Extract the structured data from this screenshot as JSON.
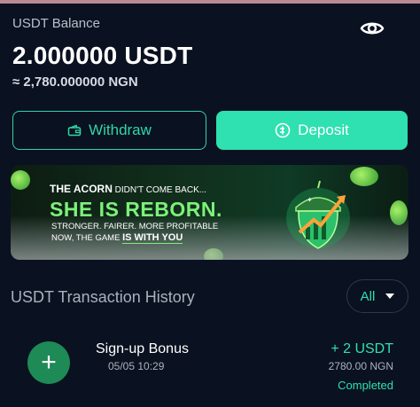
{
  "balance": {
    "label": "USDT Balance",
    "amount": "2.000000 USDT",
    "fiat": "≈ 2,780.000000 NGN",
    "visibility_icon": "eye-icon"
  },
  "actions": {
    "withdraw_label": "Withdraw",
    "withdraw_icon": "wallet-icon",
    "deposit_label": "Deposit",
    "deposit_icon": "deposit-icon"
  },
  "banner": {
    "line1_bold": "THE ACORN",
    "line1_rest": " DIDN'T COME BACK...",
    "line2": "SHE IS REBORN.",
    "line3": "STRONGER. FAIRER. MORE PROFITABLE",
    "line4_prefix": "NOW, THE GAME ",
    "line4_bold": "IS WITH YOU"
  },
  "history": {
    "title": "USDT Transaction History",
    "filter_value": "All"
  },
  "transactions": [
    {
      "title": "Sign-up Bonus",
      "date": "05/05 10:29",
      "amount": "+ 2 USDT",
      "fiat": "2780.00 NGN",
      "status": "Completed",
      "icon": "plus-icon"
    }
  ],
  "colors": {
    "accent": "#2fe0b0",
    "background": "#0a1120",
    "tx_icon_bg": "#1e8a55"
  }
}
